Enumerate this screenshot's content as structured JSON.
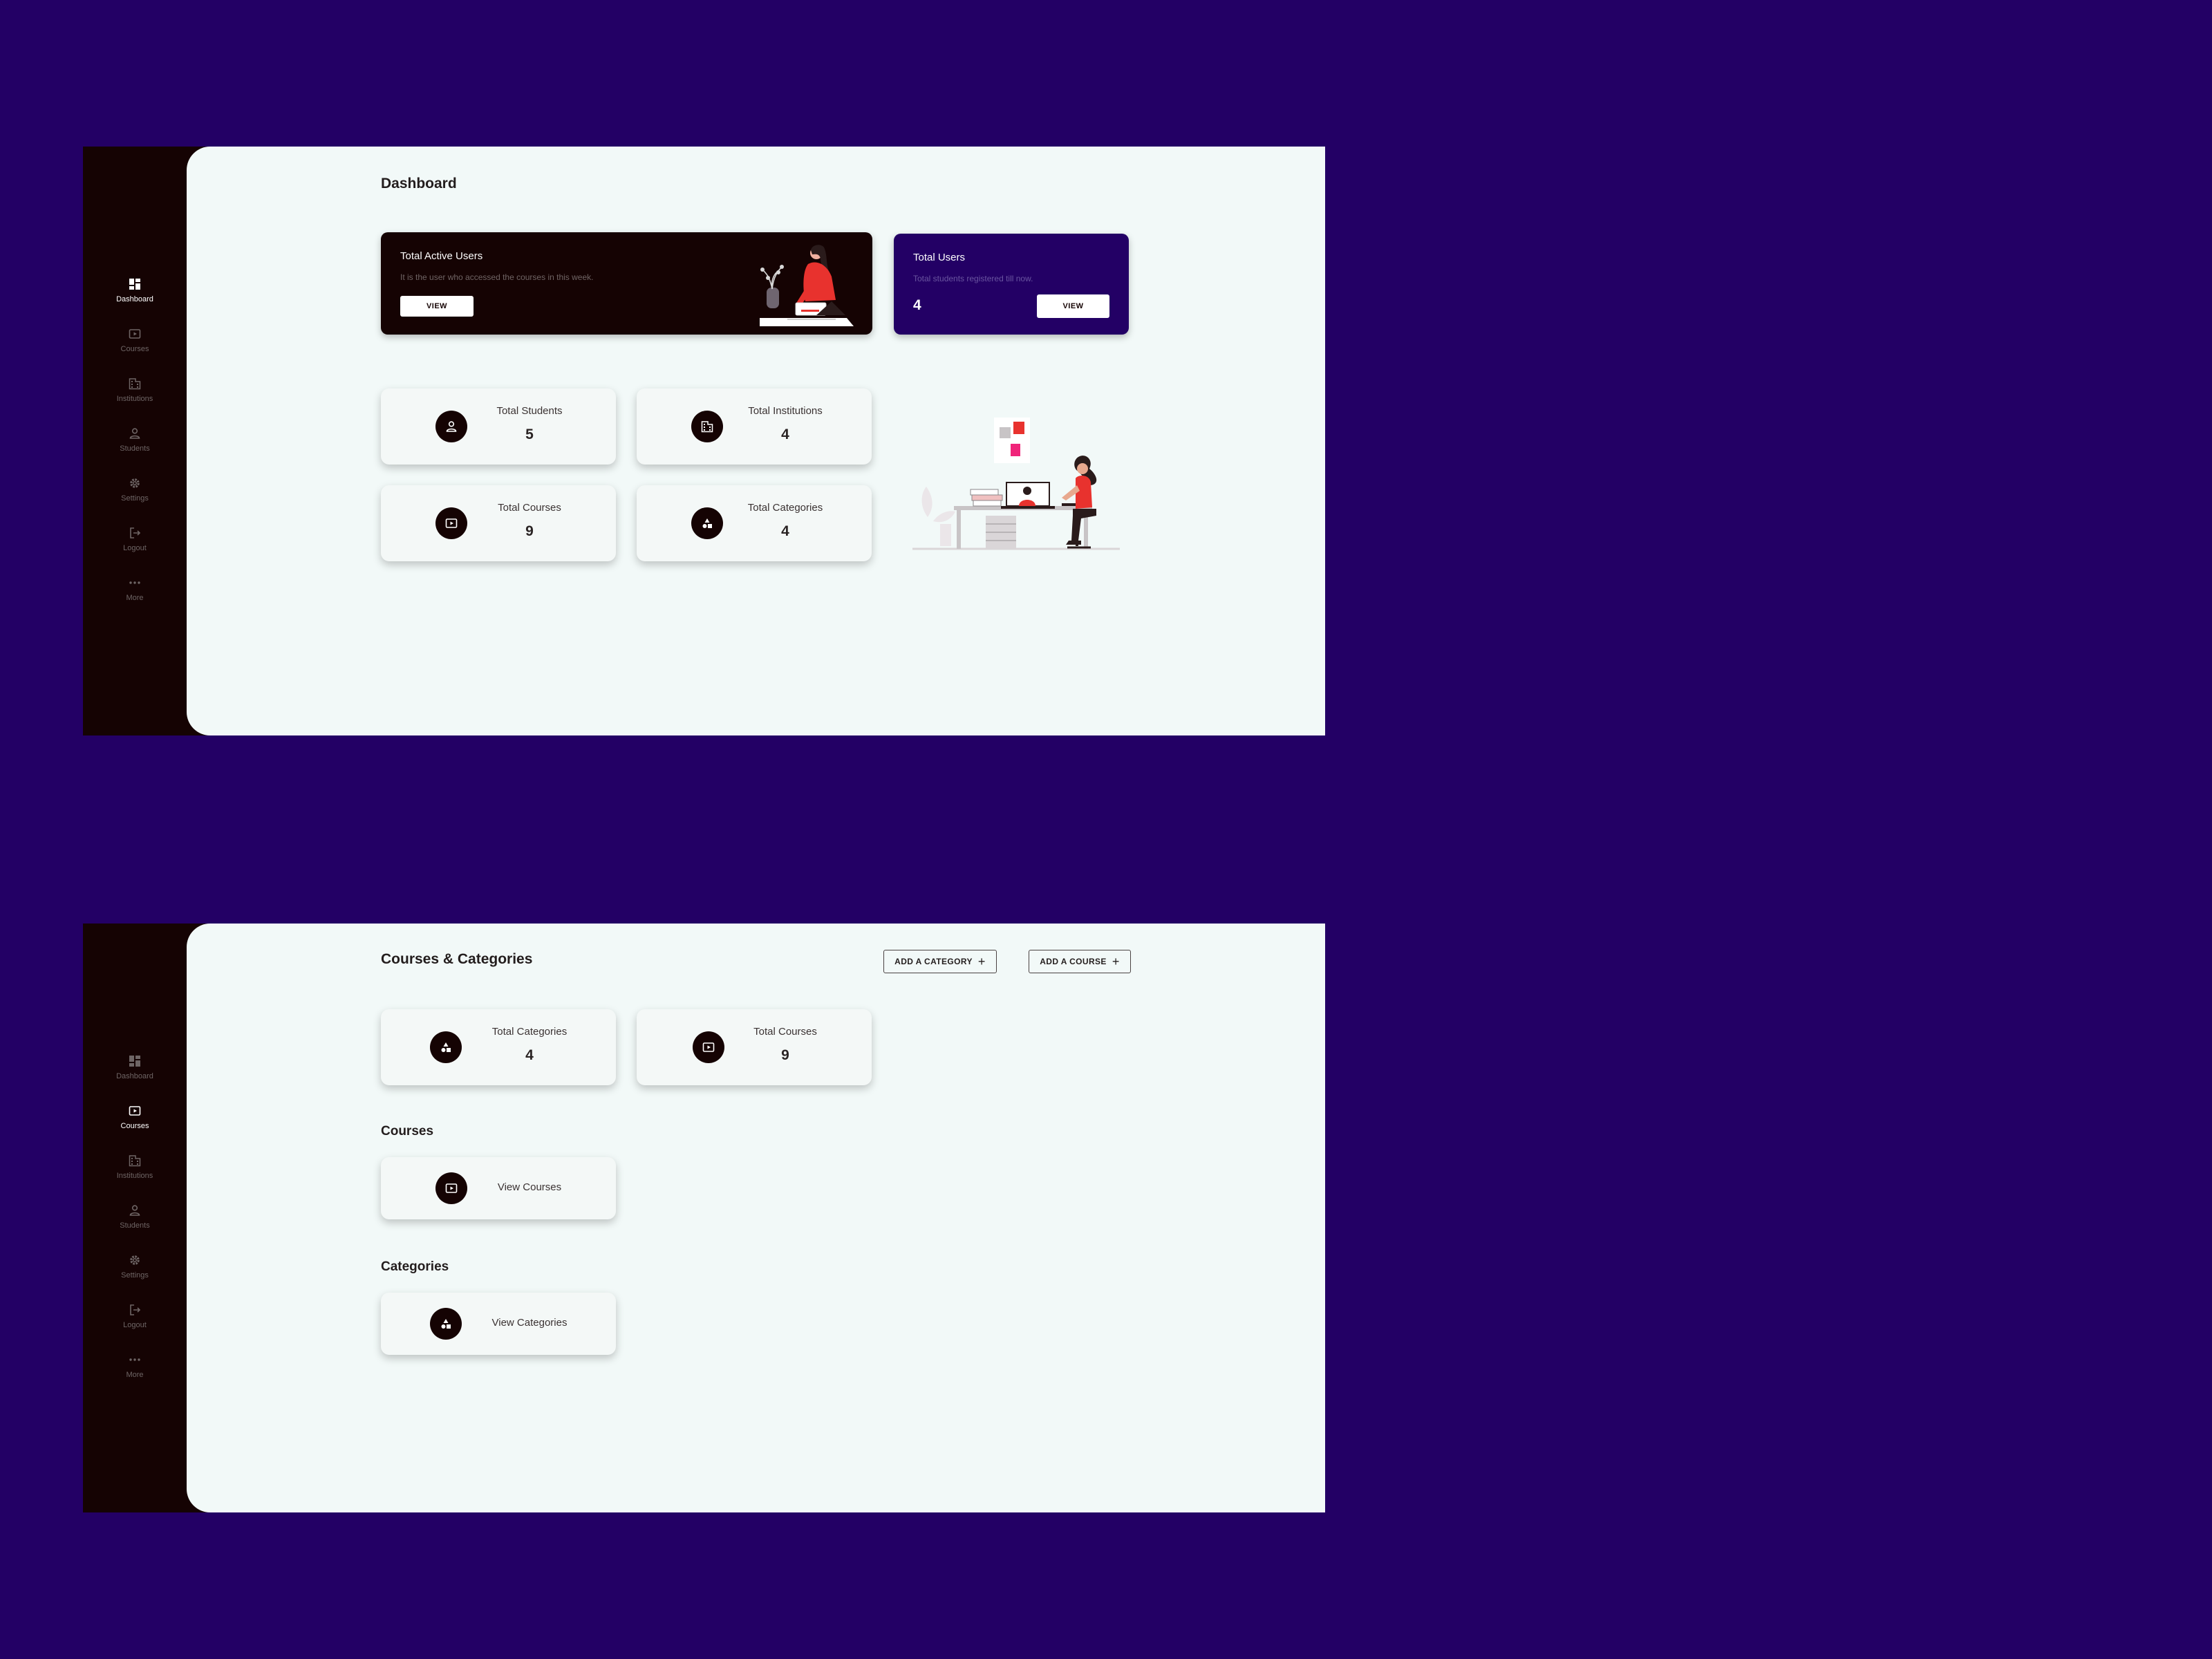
{
  "nav": {
    "items": [
      {
        "label": "Dashboard",
        "icon": "dashboard-icon"
      },
      {
        "label": "Courses",
        "icon": "play-box-icon"
      },
      {
        "label": "Institutions",
        "icon": "building-icon"
      },
      {
        "label": "Students",
        "icon": "person-icon"
      },
      {
        "label": "Settings",
        "icon": "gear-icon"
      },
      {
        "label": "Logout",
        "icon": "logout-icon"
      },
      {
        "label": "More",
        "icon": "more-dots-icon"
      }
    ]
  },
  "dashboard": {
    "title": "Dashboard",
    "active_nav": "Dashboard",
    "active_users": {
      "title": "Total Active Users",
      "subtitle": "It is the user who accessed the courses in this week.",
      "button": "VIEW"
    },
    "total_users": {
      "title": "Total Users",
      "subtitle": "Total students registered till now.",
      "count": "4",
      "button": "VIEW"
    },
    "stats": [
      {
        "label": "Total Students",
        "value": "5",
        "icon": "person-icon"
      },
      {
        "label": "Total Institutions",
        "value": "4",
        "icon": "building-icon"
      },
      {
        "label": "Total Courses",
        "value": "9",
        "icon": "play-box-icon"
      },
      {
        "label": "Total Categories",
        "value": "4",
        "icon": "shapes-icon"
      }
    ]
  },
  "courses_page": {
    "title": "Courses & Categories",
    "active_nav": "Courses",
    "add_category_button": "ADD A CATEGORY",
    "add_course_button": "ADD A COURSE",
    "stats": [
      {
        "label": "Total Categories",
        "value": "4",
        "icon": "shapes-icon"
      },
      {
        "label": "Total Courses",
        "value": "9",
        "icon": "play-box-icon"
      }
    ],
    "courses_section": {
      "title": "Courses",
      "link": "View Courses"
    },
    "categories_section": {
      "title": "Categories",
      "link": "View Categories"
    }
  },
  "colors": {
    "background": "#230065",
    "sidebar": "#150303",
    "content": "#f2f9f8",
    "accent_red": "#e8322e",
    "accent_pink": "#f0247a"
  }
}
